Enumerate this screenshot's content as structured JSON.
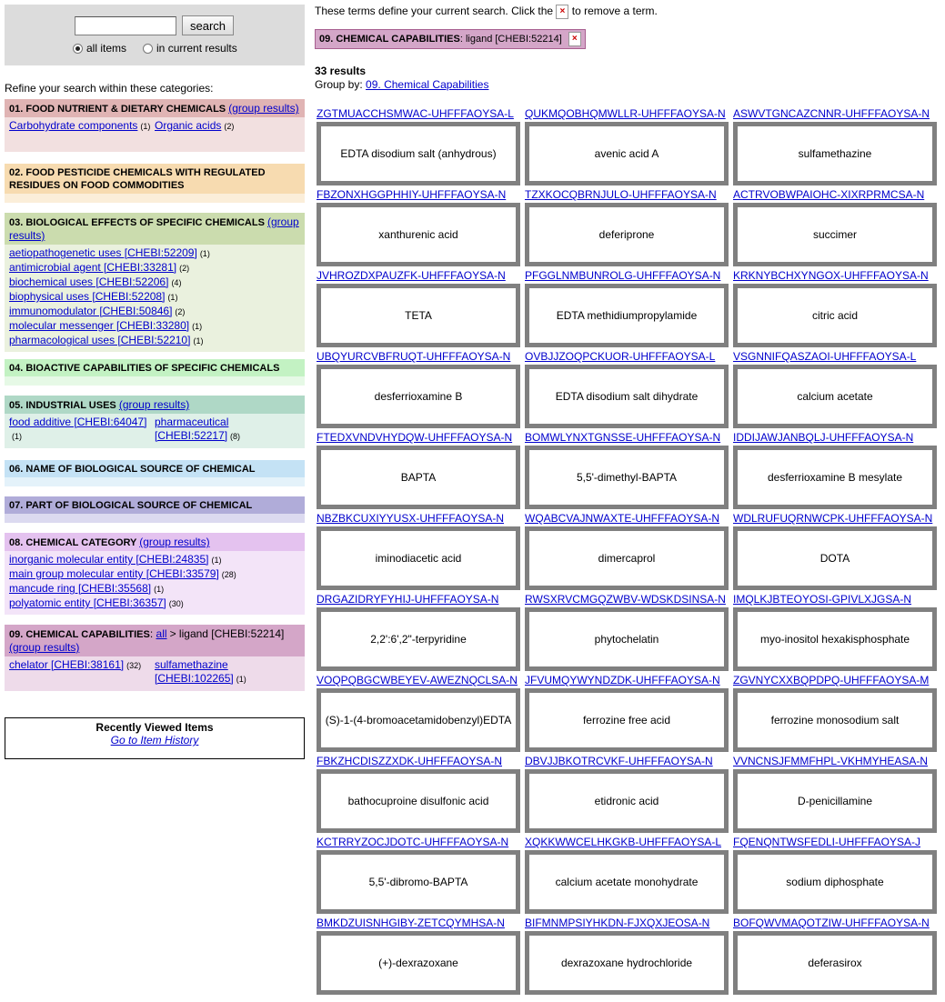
{
  "search": {
    "input_value": "",
    "button_label": "search",
    "radio_all": "all items",
    "radio_current": "in current results",
    "selected": "all items"
  },
  "refine_label": "Refine your search within these categories:",
  "categories": [
    {
      "title": "01. FOOD NUTRIENT & DIETARY CHEMICALS",
      "group_link": "(group results)",
      "color": "#e0b4b4",
      "body_color": "#f2e0e0",
      "items": [
        {
          "label": "Carbohydrate components",
          "count": "(1)"
        },
        {
          "label": "Organic acids",
          "count": "(2)"
        }
      ]
    },
    {
      "title": "02. FOOD PESTICIDE CHEMICALS WITH REGULATED RESIDUES ON FOOD COMMODITIES",
      "color": "#f7dbb0",
      "body_color": "#fbeed9"
    },
    {
      "title": "03. BIOLOGICAL EFFECTS OF SPECIFIC CHEMICALS",
      "group_link": "(group results)",
      "color": "#cbdcae",
      "body_color": "#eaf1de",
      "items": [
        {
          "label": "aetiopathogenetic uses [CHEBI:52209]",
          "count": "(1)"
        },
        {
          "label": "antimicrobial agent [CHEBI:33281]",
          "count": "(2)"
        },
        {
          "label": "biochemical uses [CHEBI:52206]",
          "count": "(4)"
        },
        {
          "label": "biophysical uses [CHEBI:52208]",
          "count": "(1)"
        },
        {
          "label": "immunomodulator [CHEBI:50846]",
          "count": "(2)"
        },
        {
          "label": "molecular messenger [CHEBI:33280]",
          "count": "(1)"
        },
        {
          "label": "pharmacological uses [CHEBI:52210]",
          "count": "(1)"
        }
      ]
    },
    {
      "title": "04. BIOACTIVE CAPABILITIES OF SPECIFIC CHEMICALS",
      "color": "#c3f2c3",
      "body_color": "#e6f9e6"
    },
    {
      "title": "05. INDUSTRIAL USES",
      "group_link": "(group results)",
      "color": "#afd8c6",
      "body_color": "#dff0e8",
      "items": [
        {
          "label": "food additive [CHEBI:64047]",
          "count": "(1)"
        },
        {
          "label": "pharmaceutical [CHEBI:52217]",
          "count": "(8)"
        }
      ]
    },
    {
      "title": "06. NAME OF BIOLOGICAL SOURCE OF CHEMICAL",
      "color": "#c4e2f5",
      "body_color": "#e4f2fa"
    },
    {
      "title": "07. PART OF BIOLOGICAL SOURCE OF CHEMICAL",
      "color": "#b0acd9",
      "body_color": "#dcdaf0"
    },
    {
      "title": "08. CHEMICAL CATEGORY",
      "group_link": "(group results)",
      "color": "#e4c2ef",
      "body_color": "#f3e4f8",
      "items": [
        {
          "label": "inorganic molecular entity [CHEBI:24835]",
          "count": "(1)"
        },
        {
          "label": "main group molecular entity [CHEBI:33579]",
          "count": "(28)"
        },
        {
          "label": "mancude ring [CHEBI:35568]",
          "count": "(1)"
        },
        {
          "label": "polyatomic entity [CHEBI:36357]",
          "count": "(30)"
        }
      ]
    },
    {
      "title": "09. CHEMICAL CAPABILITIES",
      "all_link": "all",
      "path": "> ligand [CHEBI:52214]",
      "group_link": "(group results)",
      "color": "#d4a6c8",
      "body_color": "#eedbea",
      "items": [
        {
          "label": "chelator [CHEBI:38161]",
          "count": "(32)"
        },
        {
          "label": "sulfamethazine [CHEBI:102265]",
          "count": "(1)"
        }
      ]
    }
  ],
  "recent": {
    "title": "Recently Viewed Items",
    "link": "Go to Item History"
  },
  "terms_text_before": "These terms define your current search. Click the",
  "terms_text_after": "to remove a term.",
  "remove_icon": "×",
  "active_term": {
    "category": "09. CHEMICAL CAPABILITIES",
    "value": ": ligand [CHEBI:52214]"
  },
  "results_count": "33 results",
  "group_by_label": "Group by:",
  "group_by_link": "09. Chemical Capabilities",
  "results": [
    {
      "key": "ZGTMUACCHSMWAC-UHFFFAOYSA-L",
      "name": "EDTA disodium salt (anhydrous)"
    },
    {
      "key": "QUKMQOBHQMWLLR-UHFFFAOYSA-N",
      "name": "avenic acid A"
    },
    {
      "key": "ASWVTGNCAZCNNR-UHFFFAOYSA-N",
      "name": "sulfamethazine"
    },
    {
      "key": "FBZONXHGGPHHIY-UHFFFAOYSA-N",
      "name": "xanthurenic acid"
    },
    {
      "key": "TZXKOCQBRNJULO-UHFFFAOYSA-N",
      "name": "deferiprone"
    },
    {
      "key": "ACTRVOBWPAIOHC-XIXRPRMCSA-N",
      "name": "succimer"
    },
    {
      "key": "JVHROZDXPAUZFK-UHFFFAOYSA-N",
      "name": "TETA"
    },
    {
      "key": "PFGGLNMBUNROLG-UHFFFAOYSA-N",
      "name": "EDTA methidiumpropylamide"
    },
    {
      "key": "KRKNYBCHXYNGOX-UHFFFAOYSA-N",
      "name": "citric acid"
    },
    {
      "key": "UBQYURCVBFRUQT-UHFFFAOYSA-N",
      "name": "desferrioxamine B"
    },
    {
      "key": "OVBJJZOQPCKUOR-UHFFFAOYSA-L",
      "name": "EDTA disodium salt dihydrate"
    },
    {
      "key": "VSGNNIFQASZAOI-UHFFFAOYSA-L",
      "name": "calcium acetate"
    },
    {
      "key": "FTEDXVNDVHYDQW-UHFFFAOYSA-N",
      "name": "BAPTA"
    },
    {
      "key": "BOMWLYNXTGNSSE-UHFFFAOYSA-N",
      "name": "5,5'-dimethyl-BAPTA"
    },
    {
      "key": "IDDIJAWJANBQLJ-UHFFFAOYSA-N",
      "name": "desferrioxamine B mesylate"
    },
    {
      "key": "NBZBKCUXIYYUSX-UHFFFAOYSA-N",
      "name": "iminodiacetic acid"
    },
    {
      "key": "WQABCVAJNWAXTE-UHFFFAOYSA-N",
      "name": "dimercaprol"
    },
    {
      "key": "WDLRUFUQRNWCPK-UHFFFAOYSA-N",
      "name": "DOTA"
    },
    {
      "key": "DRGAZIDRYFYHIJ-UHFFFAOYSA-N",
      "name": "2,2':6',2\"-terpyridine"
    },
    {
      "key": "RWSXRVCMGQZWBV-WDSKDSINSA-N",
      "name": "phytochelatin"
    },
    {
      "key": "IMQLKJBTEOYOSI-GPIVLXJGSA-N",
      "name": "myo-inositol hexakisphosphate"
    },
    {
      "key": "VOQPQBGCWBEYEV-AWEZNQCLSA-N",
      "name": "(S)-1-(4-bromoacetamidobenzyl)EDTA"
    },
    {
      "key": "JFVUMQYWYNDZDK-UHFFFAOYSA-N",
      "name": "ferrozine free acid"
    },
    {
      "key": "ZGVNYCXXBQPDPQ-UHFFFAOYSA-M",
      "name": "ferrozine monosodium salt"
    },
    {
      "key": "FBKZHCDISZZXDK-UHFFFAOYSA-N",
      "name": "bathocuproine disulfonic acid"
    },
    {
      "key": "DBVJJBKOTRCVKF-UHFFFAOYSA-N",
      "name": "etidronic acid"
    },
    {
      "key": "VVNCNSJFMMFHPL-VKHMYHEASA-N",
      "name": "D-penicillamine"
    },
    {
      "key": "KCTRRYZOCJDOTC-UHFFFAOYSA-N",
      "name": "5,5'-dibromo-BAPTA"
    },
    {
      "key": "XQKKWWCELHKGKB-UHFFFAOYSA-L",
      "name": "calcium acetate monohydrate"
    },
    {
      "key": "FQENQNTWSFEDLI-UHFFFAOYSA-J",
      "name": "sodium diphosphate"
    },
    {
      "key": "BMKDZUISNHGIBY-ZETCQYMHSA-N",
      "name": "(+)-dexrazoxane"
    },
    {
      "key": "BIFMNMPSIYHKDN-FJXQXJEOSA-N",
      "name": "dexrazoxane hydrochloride"
    },
    {
      "key": "BOFQWVMAQOTZIW-UHFFFAOYSA-N",
      "name": "deferasirox"
    }
  ]
}
